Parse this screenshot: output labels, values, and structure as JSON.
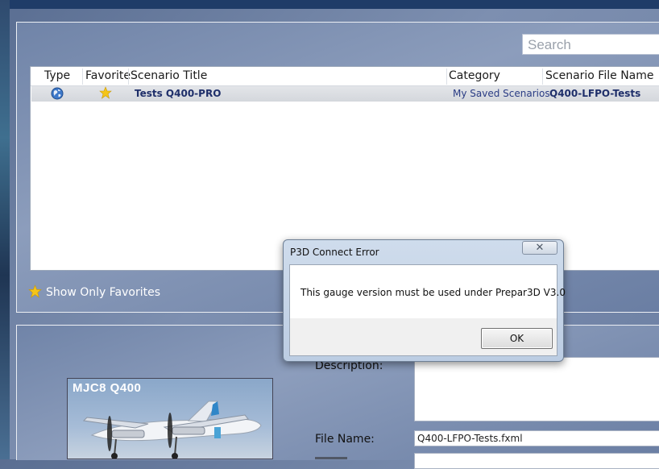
{
  "search": {
    "placeholder": "Search"
  },
  "grid": {
    "columns": [
      "Type",
      "Favorite",
      "Scenario Title",
      "Category",
      "Scenario File Name"
    ],
    "rows": [
      {
        "type_icon": "globe-icon",
        "favorite_icon": "star-icon",
        "title": "Tests Q400-PRO",
        "category": "My Saved Scenarios",
        "file_name": "Q400-LFPO-Tests"
      }
    ]
  },
  "favorites": {
    "label": "Show Only Favorites",
    "icon": "star-icon"
  },
  "details": {
    "description_label": "Description:",
    "file_name_label": "File Name:",
    "file_name_value": "Q400-LFPO-Tests.fxml",
    "thumbnail_caption": "MJC8 Q400"
  },
  "dialog": {
    "title": "P3D Connect Error",
    "message": "This gauge version must be used under Prepar3D V3.0",
    "ok_label": "OK",
    "close_symbol": "✕"
  },
  "colors": {
    "accent_navy": "#1f2f6a",
    "favorite_star": "#f5c518",
    "panel_bg": "#7d8fb0"
  }
}
